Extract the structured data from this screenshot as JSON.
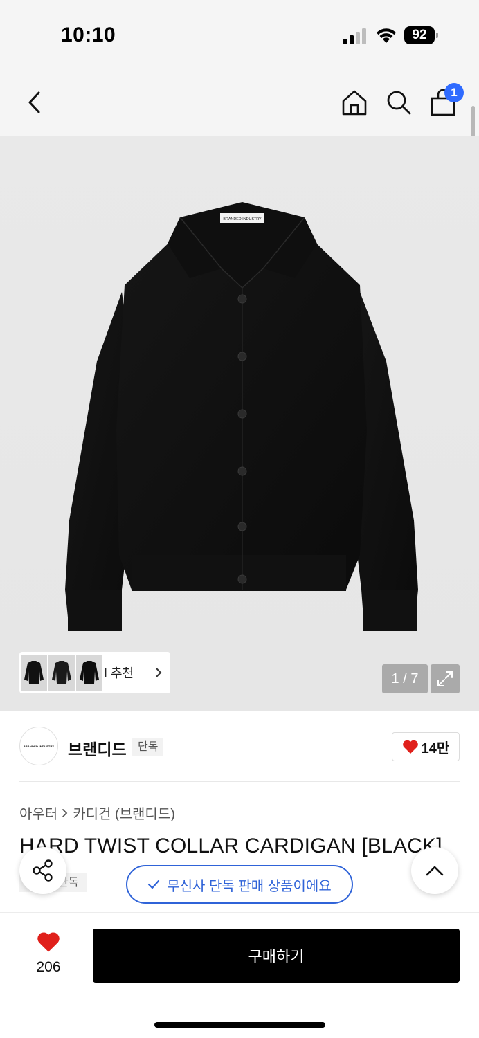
{
  "status_bar": {
    "time": "10:10",
    "battery": "92"
  },
  "header": {
    "cart_count": "1"
  },
  "gallery": {
    "recommend_label": "I 추천",
    "counter": "1 / 7",
    "garment_label_text": "BRANDED INDUSTRY"
  },
  "brand": {
    "logo_text": "BRANDED INDUSTRY",
    "name": "브랜디드",
    "tag": "단독",
    "like_count": "14만"
  },
  "breadcrumb": {
    "category": "아우터",
    "subcategory": "카디건 (브랜디드)"
  },
  "product": {
    "title": "HARD TWIST COLLAR CARDIGAN [BLACK]",
    "exclusive_tag": "단독"
  },
  "exclusive_notice": "무신사 단독 판매 상품이에요",
  "bottom_bar": {
    "like_count": "206",
    "buy_label": "구매하기"
  },
  "colors": {
    "accent_blue": "#2f63d8",
    "badge_blue": "#2f6bff",
    "heart_red": "#e0201b"
  }
}
